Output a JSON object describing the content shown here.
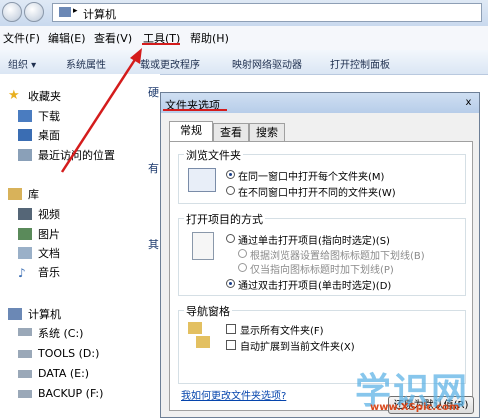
{
  "address": {
    "path": "计算机"
  },
  "menu": [
    "文件(F)",
    "编辑(E)",
    "查看(V)",
    "工具(T)",
    "帮助(H)"
  ],
  "toolbar": [
    "组织",
    "系统属性",
    "载或更改程序",
    "映射网络驱动器",
    "打开控制面板"
  ],
  "nav": {
    "favorites": "收藏夹",
    "fav_items": [
      "下载",
      "桌面",
      "最近访问的位置"
    ],
    "libraries": "库",
    "lib_items": [
      "视频",
      "图片",
      "文档",
      "音乐"
    ],
    "computer": "计算机",
    "drives": [
      "系统 (C:)",
      "TOOLS (D:)",
      "DATA (E:)",
      "BACKUP (F:)"
    ]
  },
  "bg_text": {
    "hdd": "硬",
    "other": "有",
    "other2": "其"
  },
  "dialog": {
    "title": "文件夹选项",
    "close": "x",
    "tabs": [
      "常规",
      "查看",
      "搜索"
    ],
    "browse": {
      "label": "浏览文件夹",
      "opt1": "在同一窗口中打开每个文件夹(M)",
      "opt2": "在不同窗口中打开不同的文件夹(W)"
    },
    "open": {
      "label": "打开项目的方式",
      "opt1": "通过单击打开项目(指向时选定)(S)",
      "sub1": "根据浏览器设置给图标标题加下划线(B)",
      "sub2": "仅当指向图标标题时加下划线(P)",
      "opt2": "通过双击打开项目(单击时选定)(D)"
    },
    "nav": {
      "label": "导航窗格",
      "chk1": "显示所有文件夹(F)",
      "chk2": "自动扩展到当前文件夹(X)"
    },
    "restore": "还原为默认值(R)",
    "help": "我如何更改文件夹选项?"
  },
  "watermark": {
    "text": "学识网",
    "url": "www.XSpic.com"
  },
  "colors": {
    "accent_red": "#d41c1c",
    "link": "#0645ad",
    "title_bar": "#b7cde9"
  }
}
